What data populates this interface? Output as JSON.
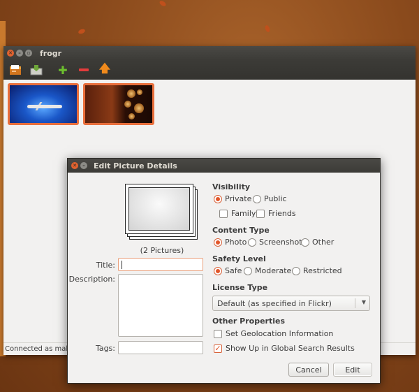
{
  "colors": {
    "accent": "#e96f3c",
    "radio_on": "#e2562a",
    "titlebar": "#3c3b37"
  },
  "frogr": {
    "title": "frogr",
    "toolbar": {
      "open_icon": "folder-open-icon",
      "upload_icon": "upload-icon",
      "add_icon": "add-icon",
      "remove_icon": "remove-icon",
      "up_icon": "arrow-up-icon"
    },
    "status": "Connected as makin"
  },
  "dialog": {
    "title": "Edit Picture Details",
    "preview_caption": "(2 Pictures)",
    "fields": {
      "title_label": "Title:",
      "title_value": "",
      "description_label": "Description:",
      "description_value": "",
      "tags_label": "Tags:",
      "tags_value": ""
    },
    "visibility": {
      "heading": "Visibility",
      "private": "Private",
      "public": "Public",
      "family": "Family",
      "friends": "Friends",
      "selected": "Private"
    },
    "content_type": {
      "heading": "Content Type",
      "photo": "Photo",
      "screenshot": "Screenshot",
      "other": "Other",
      "selected": "Photo"
    },
    "safety_level": {
      "heading": "Safety Level",
      "safe": "Safe",
      "moderate": "Moderate",
      "restricted": "Restricted",
      "selected": "Safe"
    },
    "license": {
      "heading": "License Type",
      "selected": "Default (as specified in Flickr)"
    },
    "other": {
      "heading": "Other Properties",
      "geolocation": "Set Geolocation Information",
      "geolocation_checked": false,
      "global_search": "Show Up in Global Search Results",
      "global_search_checked": true
    },
    "buttons": {
      "cancel": "Cancel",
      "edit": "Edit"
    }
  }
}
